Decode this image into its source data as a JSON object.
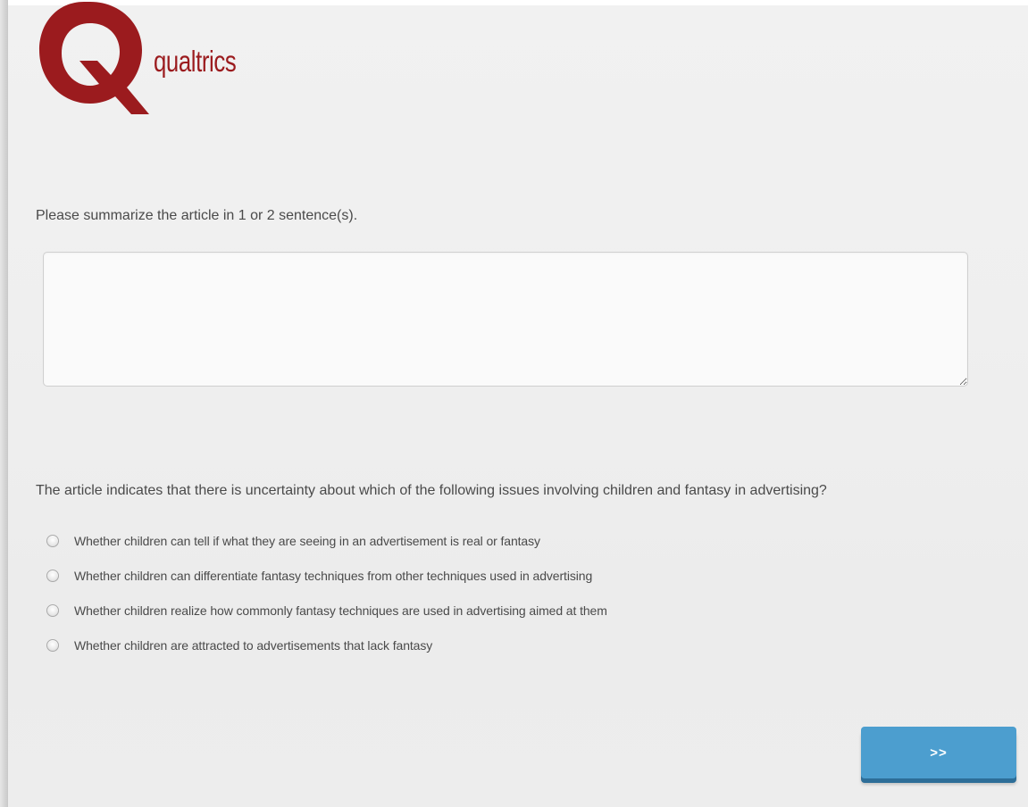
{
  "logo": {
    "brand_text": "qualtrics",
    "brand_color": "#9b1b1e"
  },
  "questions": [
    {
      "text": "Please summarize the article in 1 or 2 sentence(s).",
      "type": "text-entry",
      "value": "",
      "placeholder": ""
    },
    {
      "text": "The article indicates that there is uncertainty about which of the following issues involving children and fantasy in advertising?",
      "type": "multiple-choice",
      "choices": [
        {
          "label": "Whether children can tell if what they are seeing in an advertisement is real or fantasy",
          "selected": false
        },
        {
          "label": "Whether children can differentiate fantasy techniques from other techniques used in advertising",
          "selected": false
        },
        {
          "label": "Whether children realize how commonly fantasy techniques are used in advertising aimed at them",
          "selected": false
        },
        {
          "label": "Whether children are attracted to advertisements that lack fantasy",
          "selected": false
        }
      ]
    }
  ],
  "navigation": {
    "next_label": ">>",
    "button_color": "#4c9ecf"
  }
}
